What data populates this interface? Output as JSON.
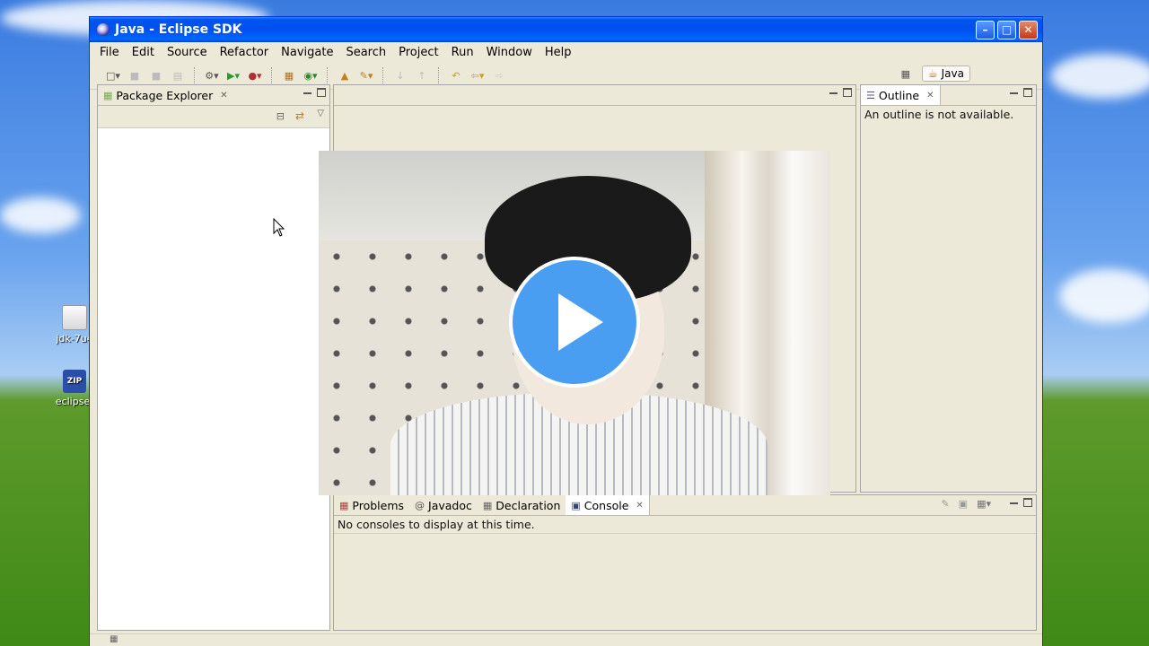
{
  "window": {
    "title": "Java - Eclipse SDK"
  },
  "menu": [
    "File",
    "Edit",
    "Source",
    "Refactor",
    "Navigate",
    "Search",
    "Project",
    "Run",
    "Window",
    "Help"
  ],
  "perspective": {
    "label": "Java"
  },
  "desktop_icons": [
    {
      "label": "jdk-7u4",
      "icon": "java-installer-icon"
    },
    {
      "label": "eclipse-",
      "icon": "zip-archive-icon"
    }
  ],
  "package_explorer": {
    "tab_label": "Package Explorer"
  },
  "outline": {
    "tab_label": "Outline",
    "message": "An outline is not available."
  },
  "bottom_panel": {
    "tabs": [
      {
        "label": "Problems",
        "icon": "problems-icon"
      },
      {
        "label": "Javadoc",
        "icon": "at-icon"
      },
      {
        "label": "Declaration",
        "icon": "declaration-icon"
      },
      {
        "label": "Console",
        "icon": "console-icon",
        "active": true
      }
    ],
    "message": "No consoles to display at this time."
  },
  "video_overlay": {
    "play_icon": "play-icon"
  },
  "colors": {
    "title_bar": "#0055ea",
    "play_button": "#4a9ef1",
    "window_bg": "#ece9d8"
  }
}
